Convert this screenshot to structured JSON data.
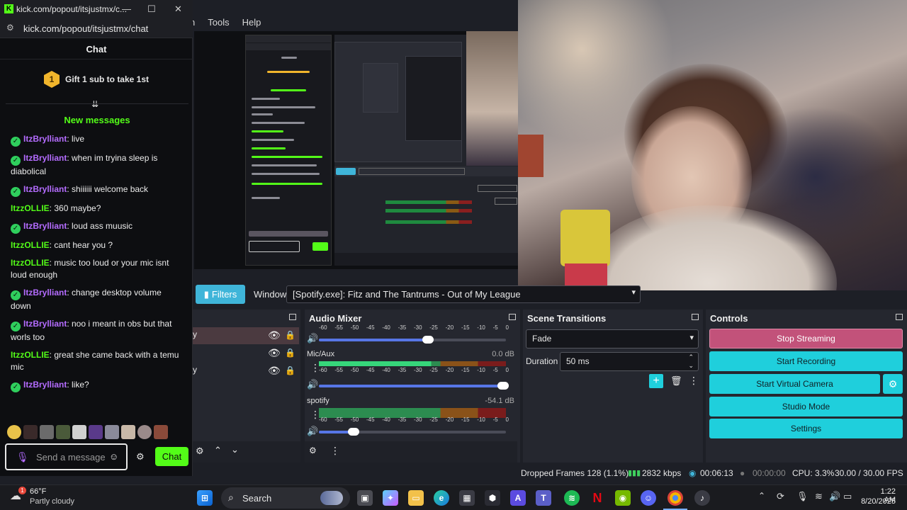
{
  "chat_window": {
    "title": "kick.com/popout/itsjustmx/c...",
    "url": "kick.com/popout/itsjustmx/chat",
    "header": "Chat",
    "gift": {
      "badge": "1",
      "text": "Gift 1 sub to take 1st"
    },
    "new_messages_label": "New messages",
    "messages": [
      {
        "user": "ItzBrylliant",
        "text": ": live",
        "color": "#b46cff",
        "verified": true
      },
      {
        "user": "ItzBrylliant",
        "text": ": when im tryina sleep is diabolical",
        "color": "#b46cff",
        "verified": true
      },
      {
        "user": "ItzBrylliant",
        "text": ": shiiiiii welcome back",
        "color": "#b46cff",
        "verified": true
      },
      {
        "user": "ItzzOLLIE",
        "text": ": 360 maybe?",
        "color": "#53fc18",
        "verified": false
      },
      {
        "user": "ItzBrylliant",
        "text": ": loud ass muusic",
        "color": "#b46cff",
        "verified": true
      },
      {
        "user": "ItzzOLLIE",
        "text": ": cant hear you ?",
        "color": "#53fc18",
        "verified": false
      },
      {
        "user": "ItzzOLLIE",
        "text": ": music too loud or your mic isnt loud enough",
        "color": "#53fc18",
        "verified": false
      },
      {
        "user": "ItzBrylliant",
        "text": ": change desktop volume down",
        "color": "#b46cff",
        "verified": true
      },
      {
        "user": "ItzBrylliant",
        "text": ": noo i meant in obs but that worls too",
        "color": "#b46cff",
        "verified": true
      },
      {
        "user": "ItzzOLLIE",
        "text": ": great she came back with a temu mic",
        "color": "#53fc18",
        "verified": false
      },
      {
        "user": "ItzBrylliant",
        "text": ": like?",
        "color": "#b46cff",
        "verified": true
      }
    ],
    "input_placeholder": "Send a message",
    "send_label": "Chat"
  },
  "obs": {
    "menu": [
      "Tools",
      "Help"
    ],
    "filters_label": "Filters",
    "window_label": "Window",
    "window_value": "[Spotify.exe]: Fitz and The Tantrums - Out of My League",
    "audio_mixer": {
      "title": "Audio Mixer",
      "ticks": [
        "-60",
        "-55",
        "-50",
        "-45",
        "-40",
        "-35",
        "-30",
        "-25",
        "-20",
        "-15",
        "-10",
        "-5",
        "0"
      ],
      "channels": [
        {
          "name": "",
          "db": "",
          "volume": 0.6
        },
        {
          "name": "Mic/Aux",
          "db": "0.0 dB",
          "volume": 1.0
        },
        {
          "name": "spotify",
          "db": "-54.1 dB",
          "volume": 0.2
        }
      ]
    },
    "scene_transitions": {
      "title": "Scene Transitions",
      "transition": "Fade",
      "duration_label": "Duration",
      "duration_value": "50 ms"
    },
    "controls": {
      "title": "Controls",
      "stop_streaming": "Stop Streaming",
      "start_recording": "Start Recording",
      "start_virtual_camera": "Start Virtual Camera",
      "studio_mode": "Studio Mode",
      "settings": "Settings"
    },
    "status": {
      "dropped_frames": "Dropped Frames 128 (1.1%)",
      "bitrate": "2832 kbps",
      "stream_time": "00:06:13",
      "record_time": "00:00:00",
      "cpu": "CPU: 3.3%",
      "fps": "30.00 / 30.00 FPS"
    }
  },
  "taskbar": {
    "weather_temp": "66°F",
    "weather_desc": "Partly cloudy",
    "weather_badge": "1",
    "search_label": "Search",
    "time": "1:22 AM",
    "date": "8/20/2025"
  }
}
